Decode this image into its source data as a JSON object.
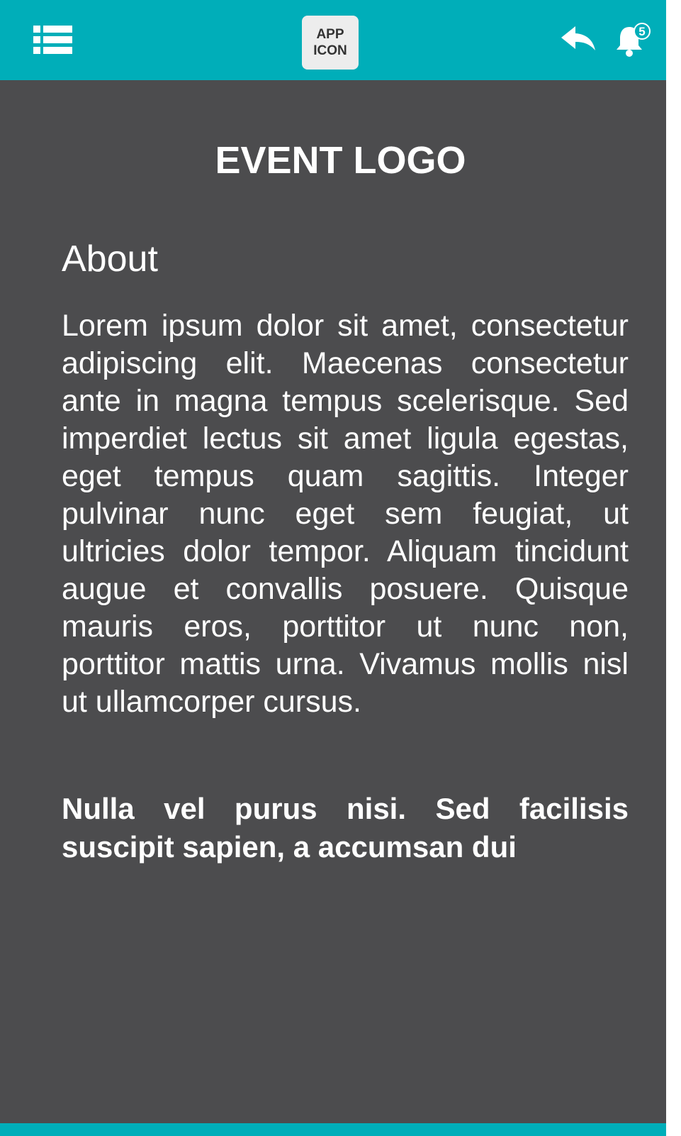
{
  "colors": {
    "accent": "#00aeb9",
    "background": "#4c4c4e",
    "text": "#ffffff",
    "app_icon_bg": "#ededed"
  },
  "header": {
    "menu_icon": "list-menu-icon",
    "app_icon_line1": "APP",
    "app_icon_line2": "ICON",
    "back_icon": "reply-arrow-icon",
    "bell_icon": "bell-icon",
    "notification_count": "5"
  },
  "main": {
    "event_logo": "EVENT LOGO",
    "about_heading": "About",
    "about_body": "Lorem ipsum dolor sit amet, consectetur adipiscing elit. Maecenas consectetur ante in magna tempus scelerisque. Sed imperdiet lectus sit amet ligula egestas, eget tempus quam sagittis. Integer pulvinar nunc eget sem feugiat, ut ultricies dolor tempor. Aliquam tincidunt augue et convallis posuere. Quisque mauris eros, porttitor ut nunc non, porttitor mattis urna. Vivamus mollis nisl ut ullamcorper cursus.",
    "about_highlight": "Nulla vel purus nisi. Sed facilisis suscipit sapien, a accumsan dui"
  }
}
